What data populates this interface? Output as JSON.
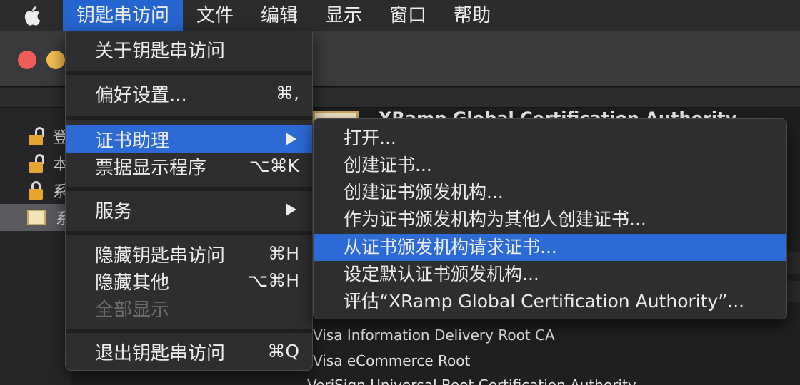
{
  "menubar": {
    "apple_icon": "apple-logo-icon",
    "items": [
      {
        "label": "钥匙串访问",
        "active": true
      },
      {
        "label": "文件"
      },
      {
        "label": "编辑"
      },
      {
        "label": "显示"
      },
      {
        "label": "窗口"
      },
      {
        "label": "帮助"
      }
    ]
  },
  "background": {
    "content_title": "XRamp Global Certification Authority",
    "sidebar_rows": [
      "登",
      "本",
      "系",
      "系"
    ],
    "list_rows": [
      "Visa Information Delivery Root CA",
      "Visa eCommerce Root",
      "VeriSign Universal Root Certification Authority"
    ]
  },
  "menu": {
    "about": "关于钥匙串访问",
    "preferences": {
      "label": "偏好设置...",
      "shortcut": "⌘,"
    },
    "cert_assistant": {
      "label": "证书助理"
    },
    "ticket_viewer": {
      "label": "票据显示程序",
      "shortcut": "⌥⌘K"
    },
    "services": {
      "label": "服务"
    },
    "hide": {
      "label": "隐藏钥匙串访问",
      "shortcut": "⌘H"
    },
    "hide_others": {
      "label": "隐藏其他",
      "shortcut": "⌥⌘H"
    },
    "show_all": {
      "label": "全部显示"
    },
    "quit": {
      "label": "退出钥匙串访问",
      "shortcut": "⌘Q"
    }
  },
  "submenu": {
    "items": [
      "打开...",
      "创建证书...",
      "创建证书颁发机构...",
      "作为证书颁发机构为其他人创建证书...",
      "从证书颁发机构请求证书...",
      "设定默认证书颁发机构...",
      "评估“XRamp Global Certification Authority”..."
    ],
    "highlighted_index": 4
  },
  "colors": {
    "highlight": "#2c6bd6",
    "menu_bg": "#2e2e31",
    "traffic_red": "#ee5d57",
    "traffic_yellow": "#f4bd4f"
  }
}
